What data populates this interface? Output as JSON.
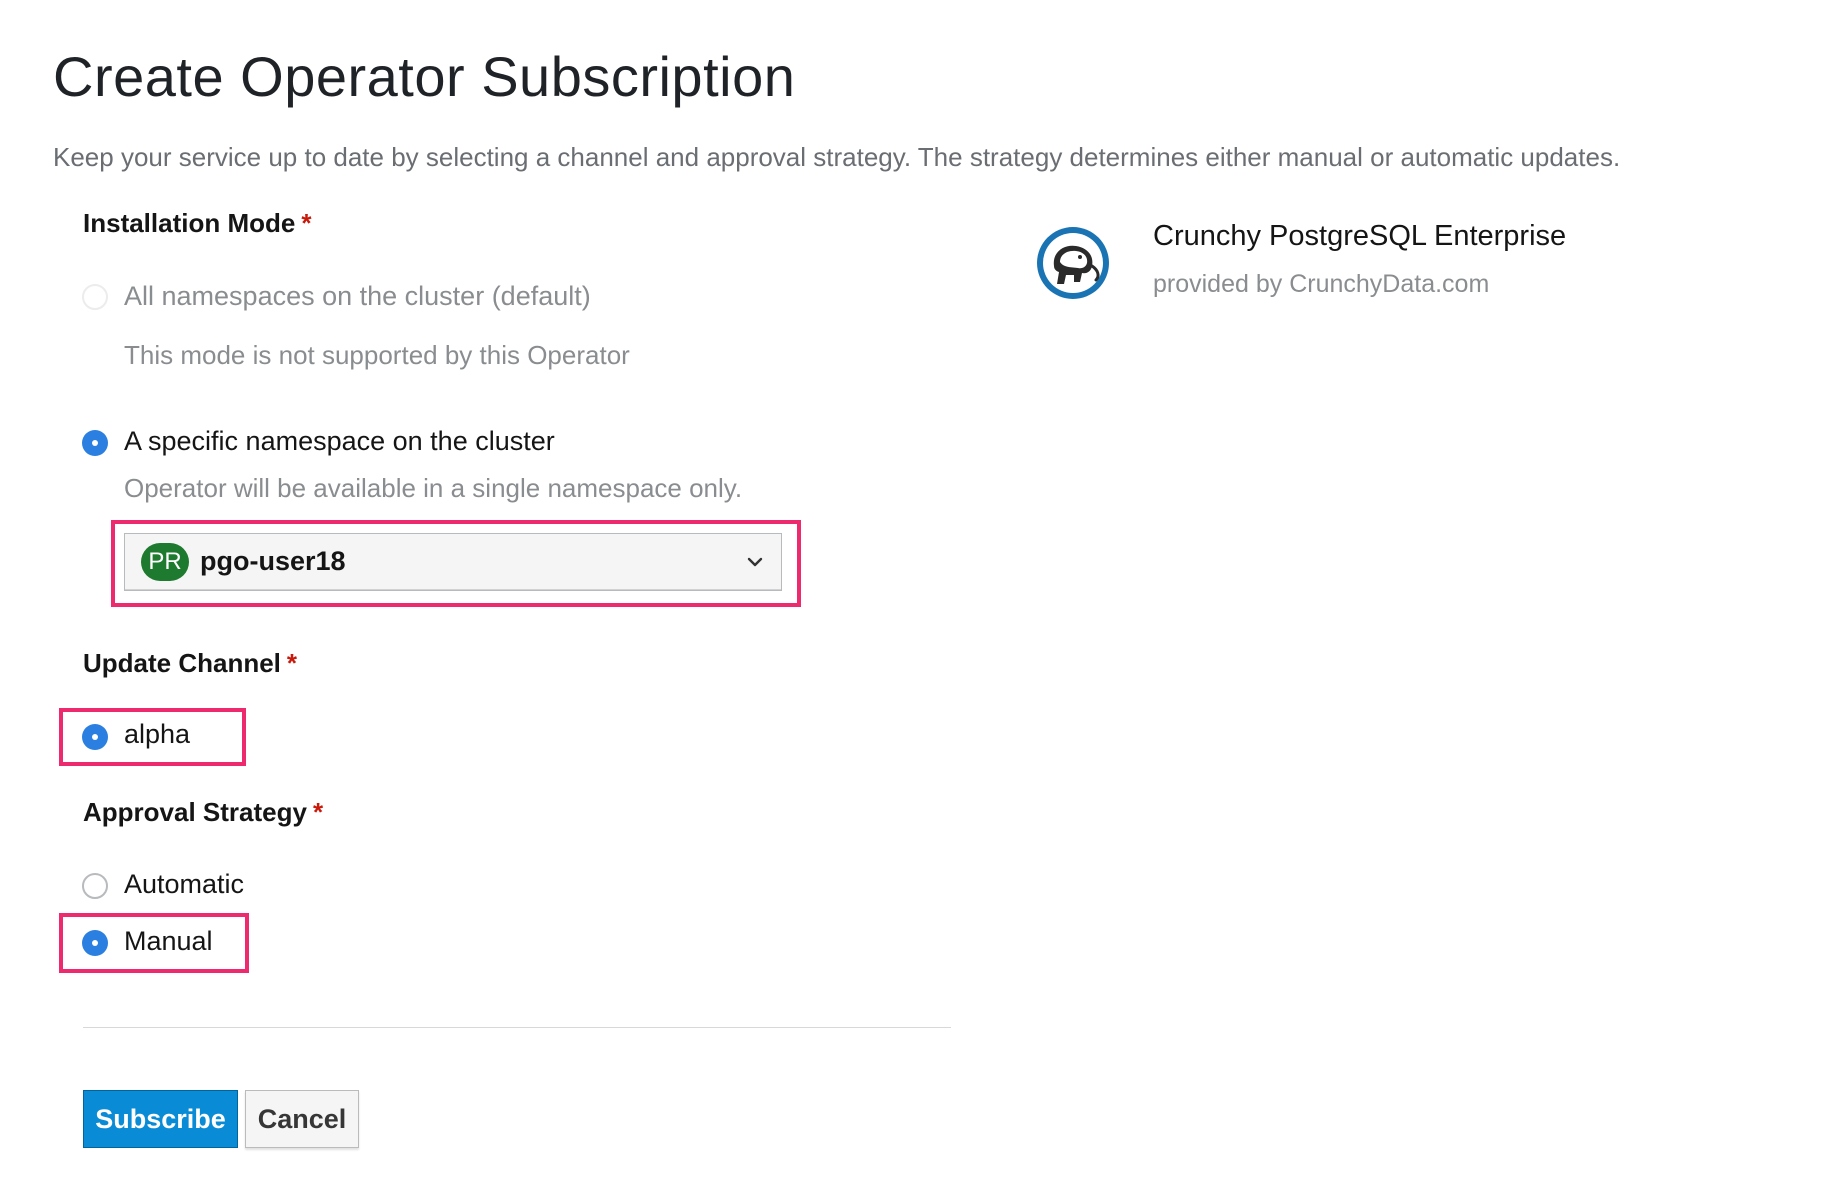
{
  "page": {
    "title": "Create Operator Subscription",
    "description": "Keep your service up to date by selecting a channel and approval strategy. The strategy determines either manual or automatic updates."
  },
  "installation_mode": {
    "label": "Installation Mode",
    "required_mark": "*",
    "options": [
      {
        "label": "All namespaces on the cluster (default)",
        "help": "This mode is not supported by this Operator",
        "checked": false,
        "disabled": true
      },
      {
        "label": "A specific namespace on the cluster",
        "help": "Operator will be available in a single namespace only.",
        "checked": true,
        "disabled": false
      }
    ],
    "namespace_select": {
      "badge": "PR",
      "value": "pgo-user18",
      "badge_color": "#1e7a2e"
    }
  },
  "update_channel": {
    "label": "Update Channel",
    "required_mark": "*",
    "options": [
      {
        "label": "alpha",
        "checked": true
      }
    ]
  },
  "approval_strategy": {
    "label": "Approval Strategy",
    "required_mark": "*",
    "options": [
      {
        "label": "Automatic",
        "checked": false
      },
      {
        "label": "Manual",
        "checked": true
      }
    ]
  },
  "actions": {
    "subscribe": "Subscribe",
    "cancel": "Cancel"
  },
  "operator": {
    "name": "Crunchy PostgreSQL Enterprise",
    "provider": "provided by CrunchyData.com",
    "logo_icon": "crunchy-elephant-logo-icon"
  },
  "colors": {
    "accent": "#2b7fe0",
    "primary_button": "#0a8bd6",
    "highlight": "#ec2a6d",
    "required": "#c9190b"
  }
}
